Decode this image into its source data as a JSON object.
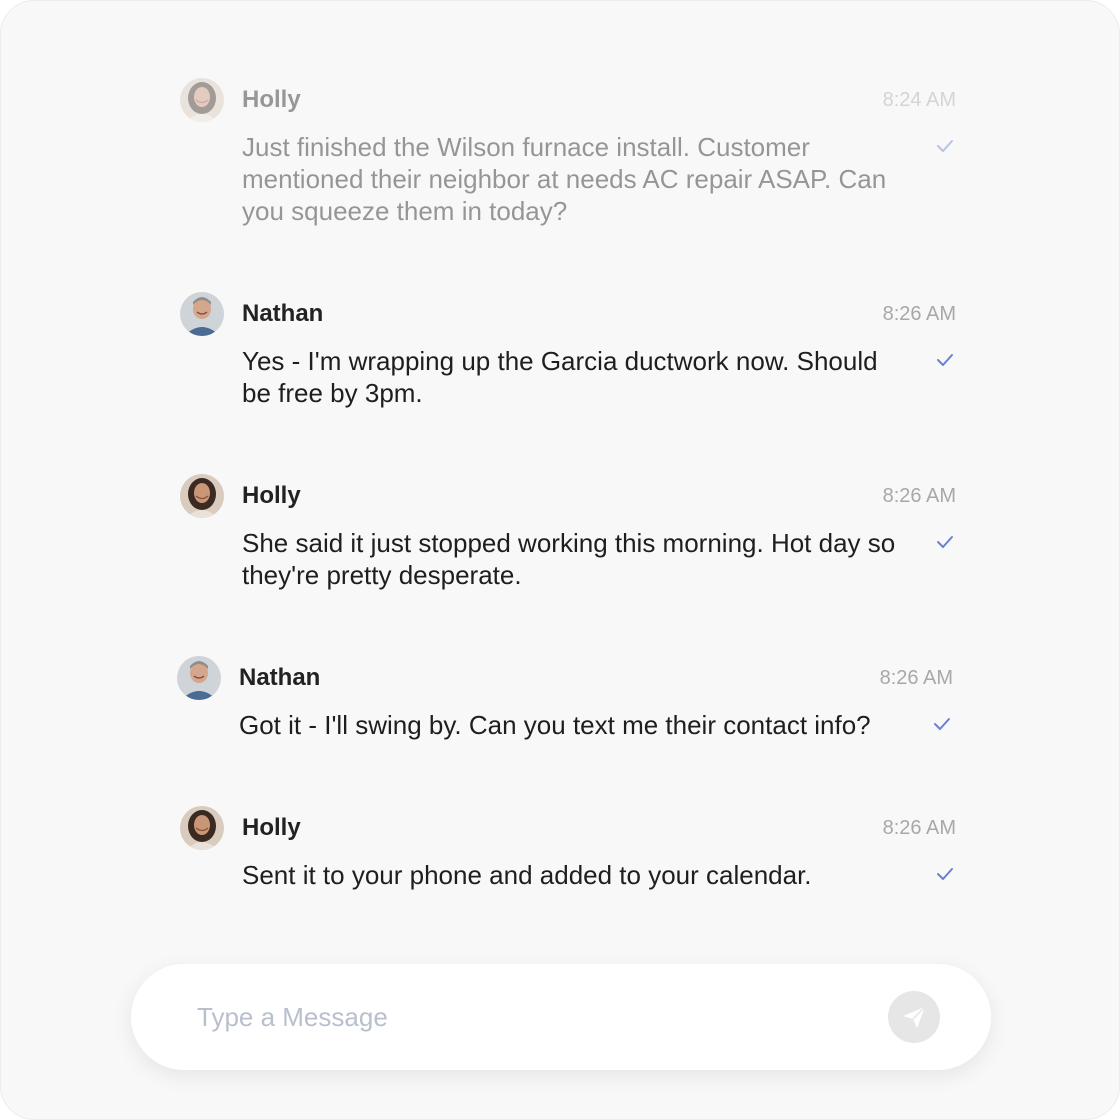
{
  "messages": [
    {
      "author": "Holly",
      "time": "8:24 AM",
      "text": "Just finished the Wilson furnace install. Customer mentioned their neighbor at needs AC repair ASAP. Can you squeeze them in today?",
      "status": "read",
      "faded": true
    },
    {
      "author": "Nathan",
      "time": "8:26 AM",
      "text": "Yes - I'm wrapping up the Garcia ductwork now. Should be free by 3pm.",
      "status": "read",
      "faded": false
    },
    {
      "author": "Holly",
      "time": "8:26 AM",
      "text": "She said it just stopped working this morning. Hot day so they're pretty desperate.",
      "status": "read",
      "faded": false
    },
    {
      "author": "Nathan",
      "time": "8:26 AM",
      "text": "Got it - I'll swing by. Can you text me their contact info?",
      "status": "read",
      "faded": false
    },
    {
      "author": "Holly",
      "time": "8:26 AM",
      "text": "Sent it to your phone and added to your calendar.",
      "status": "read",
      "faded": false
    }
  ],
  "composer": {
    "placeholder": "Type a Message",
    "value": "",
    "send_icon": "send-icon"
  },
  "colors": {
    "card_background": "#f8f8f8",
    "check_accent": "#6b7fd6",
    "send_button": "#e6e6e6",
    "placeholder": "#b9c0cd",
    "timestamp": "#a8a8a8"
  }
}
